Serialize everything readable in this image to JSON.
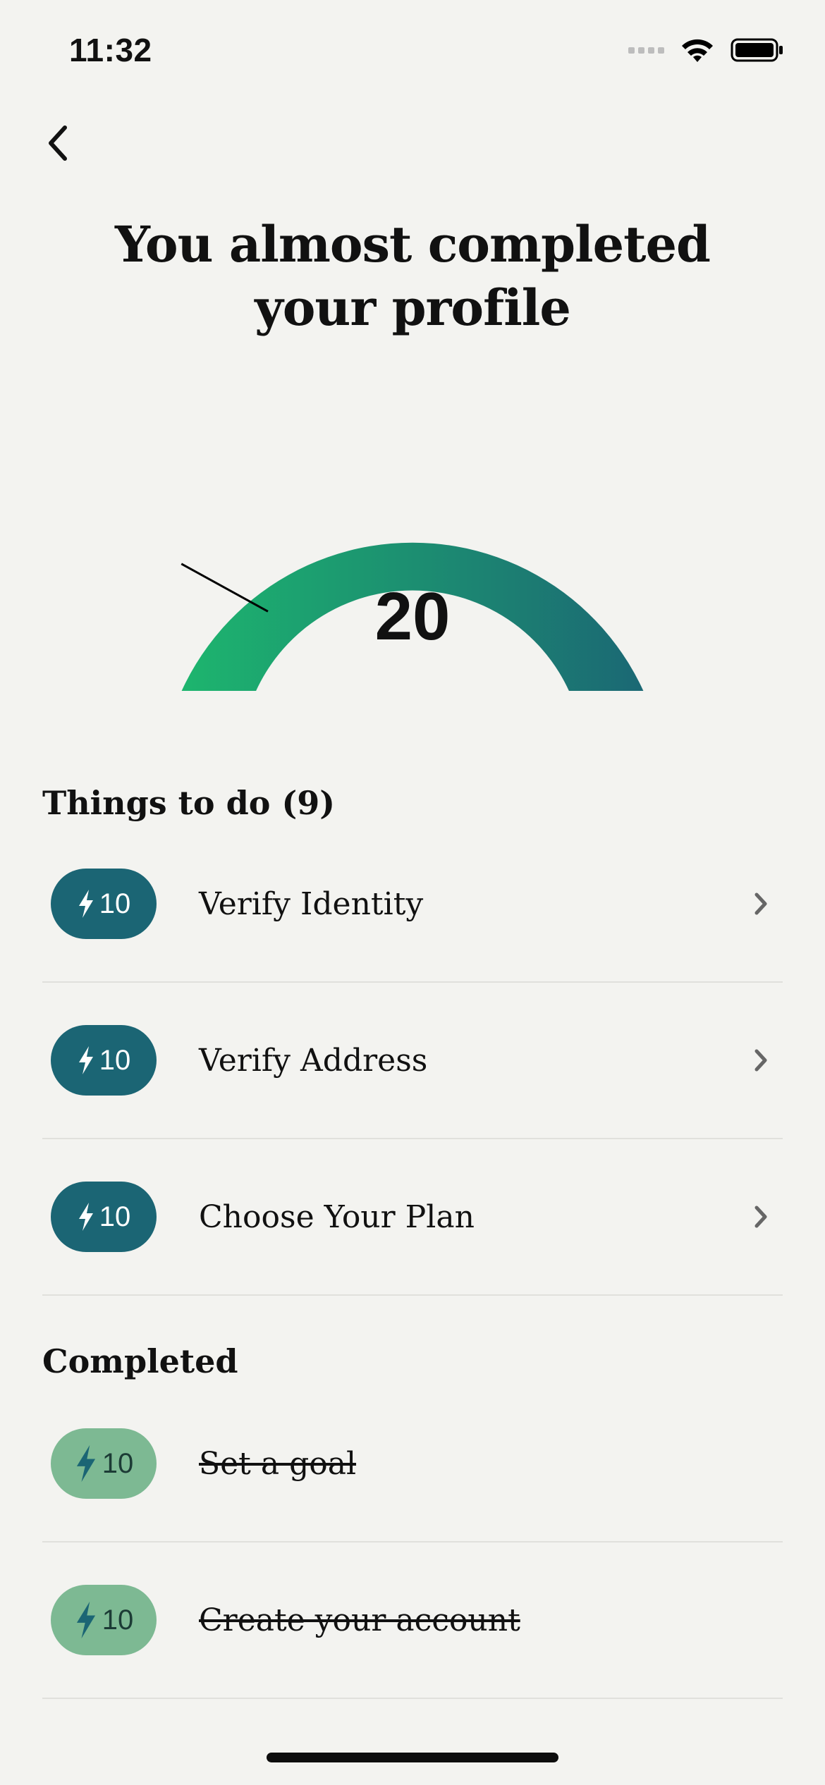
{
  "status_bar": {
    "time": "11:32"
  },
  "header": {
    "title_line1": "You almost completed",
    "title_line2": "your profile"
  },
  "gauge": {
    "value": "20",
    "percent": 20,
    "color_start": "#1db86e",
    "color_end": "#1b6574"
  },
  "todo": {
    "title": "Things to do (9)",
    "items": [
      {
        "points": "10",
        "label": "Verify Identity"
      },
      {
        "points": "10",
        "label": "Verify Address"
      },
      {
        "points": "10",
        "label": "Choose Your Plan"
      }
    ]
  },
  "completed": {
    "title": "Completed",
    "items": [
      {
        "points": "10",
        "label": "Set a goal"
      },
      {
        "points": "10",
        "label": "Create your account"
      }
    ]
  },
  "colors": {
    "badge_todo": "#1b6574",
    "badge_done": "#7db993",
    "background": "#f3f3f0"
  },
  "icons": {
    "back": "chevron-left-icon",
    "row_arrow": "chevron-right-icon",
    "points": "lightning-icon"
  }
}
